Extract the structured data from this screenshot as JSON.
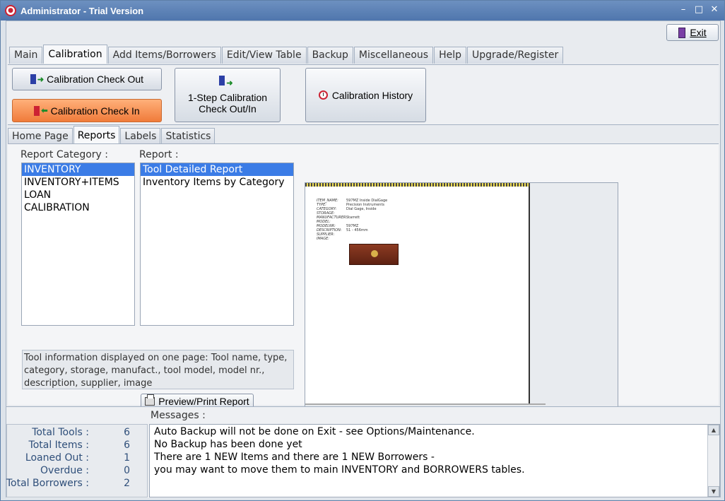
{
  "window": {
    "title": "Administrator - Trial Version"
  },
  "toolbar": {
    "exit_label": "Exit"
  },
  "tabs": [
    "Main",
    "Calibration",
    "Add Items/Borrowers",
    "Edit/View Table",
    "Backup",
    "Miscellaneous",
    "Help",
    "Upgrade/Register"
  ],
  "active_tab": "Calibration",
  "calibration": {
    "check_out": "Calibration Check Out",
    "check_in": "Calibration Check In",
    "one_step_line1": "1-Step Calibration",
    "one_step_line2": "Check Out/In",
    "history": "Calibration History"
  },
  "subtabs": [
    "Home Page",
    "Reports",
    "Labels",
    "Statistics"
  ],
  "active_subtab": "Reports",
  "reports": {
    "category_label": "Report Category :",
    "report_label": "Report :",
    "categories": [
      "INVENTORY",
      "INVENTORY+ITEMS",
      "LOAN",
      "CALIBRATION"
    ],
    "reports": [
      "Tool Detailed Report",
      "Inventory Items by Category"
    ],
    "description": "Tool information displayed on one page: Tool name, type, category, storage, manufact., tool model, model nr., description, supplier, image",
    "preview_button": "Preview/Print Report"
  },
  "preview": {
    "rows": [
      {
        "k": "ITEM_NAME:",
        "v": "597MZ Inside DialGage"
      },
      {
        "k": "TYPE:",
        "v": "Precision Instruments"
      },
      {
        "k": "CATEGORY:",
        "v": "Dial Gage, Inside"
      },
      {
        "k": "STORAGE:",
        "v": ""
      },
      {
        "k": "MANUFACTURER:",
        "v": "Starrett"
      },
      {
        "k": "MODEL:",
        "v": ""
      },
      {
        "k": "MODELNR:",
        "v": "597MZ"
      },
      {
        "k": "DESCRIPTION:",
        "v": "51 - 456mm"
      },
      {
        "k": "SUPPLIER:",
        "v": ""
      },
      {
        "k": "IMAGE:",
        "v": ""
      }
    ]
  },
  "stats": [
    {
      "label": "Total Tools :",
      "value": "6"
    },
    {
      "label": "Total Items :",
      "value": "6"
    },
    {
      "label": "Loaned Out :",
      "value": "1"
    },
    {
      "label": "Overdue :",
      "value": "0"
    },
    {
      "label": "Total Borrowers :",
      "value": "2"
    }
  ],
  "messages": {
    "label": "Messages :",
    "lines": [
      "Auto Backup will not be done on Exit - see Options/Maintenance.",
      "No Backup has been done yet",
      "There are 1 NEW Items and there are 1 NEW Borrowers -",
      "you may want to move them to main INVENTORY and BORROWERS tables."
    ]
  }
}
